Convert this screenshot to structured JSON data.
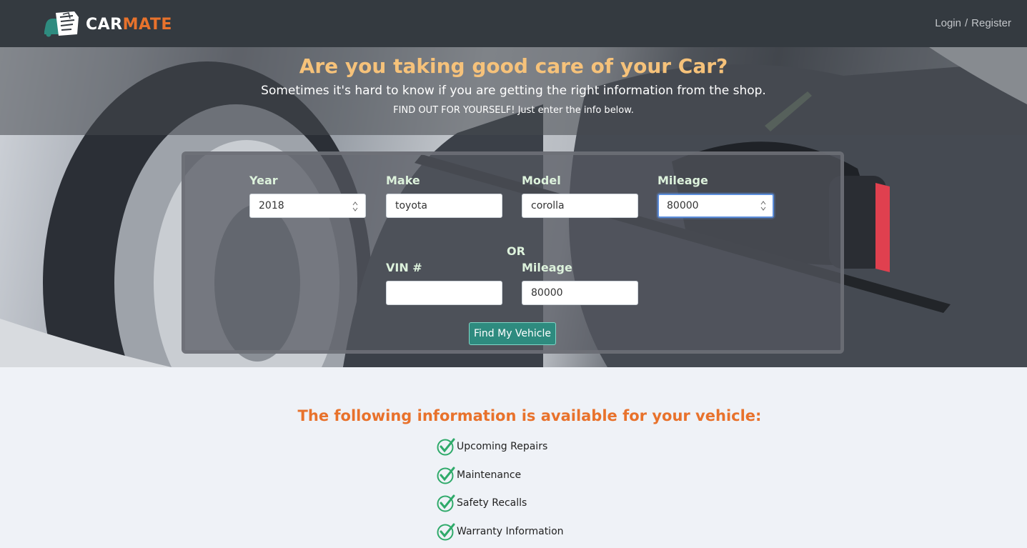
{
  "brand": {
    "text_primary": "CAR",
    "text_accent": "MATE",
    "logo_icon": "car-mechanic-logo",
    "accent_color": "#e8722c"
  },
  "nav": {
    "login": "Login",
    "separator": "/",
    "register": "Register"
  },
  "hero": {
    "title": "Are you taking good care of your Car?",
    "subtitle": "Sometimes it's hard to know if you are getting the right information from the shop.",
    "tagline": "FIND OUT FOR YOURSELF! Just enter the info below."
  },
  "form": {
    "year": {
      "label": "Year",
      "value": "2018"
    },
    "make": {
      "label": "Make",
      "value": "toyota"
    },
    "model": {
      "label": "Model",
      "value": "corolla"
    },
    "mileage": {
      "label": "Mileage",
      "value": "80000"
    },
    "or_label": "OR",
    "vin": {
      "label": "VIN #",
      "value": ""
    },
    "vin_mileage": {
      "label": "Mileage",
      "value": "80000"
    },
    "submit": "Find My Vehicle"
  },
  "info": {
    "title": "The following information is available for your vehicle:",
    "items": [
      {
        "label": "Upcoming Repairs",
        "icon": "check-icon"
      },
      {
        "label": "Maintenance",
        "icon": "check-icon"
      },
      {
        "label": "Safety Recalls",
        "icon": "check-icon"
      },
      {
        "label": "Warranty Information",
        "icon": "check-icon"
      }
    ]
  },
  "colors": {
    "navbar": "#343a40",
    "title": "#f6c27a",
    "label": "#ddf2dc",
    "button": "#2e8b7f",
    "check": "#2faa6a"
  }
}
